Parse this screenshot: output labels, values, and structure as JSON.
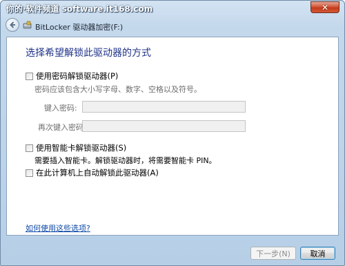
{
  "watermark": "你的·软件频道 software.it168.com",
  "window": {
    "title": "BitLocker 驱动器加密(F:)",
    "close_label": "✕"
  },
  "icons": {
    "back": "back-arrow-icon",
    "app": "bitlocker-icon"
  },
  "main": {
    "heading": "选择希望解锁此驱动器的方式",
    "option_password": "使用密码解锁驱动器(P)",
    "password_hint": "密码应该包含大小写字母、数字、空格以及符号。",
    "enter_password_label": "键入密码:",
    "reenter_password_label": "再次键入密码:",
    "enter_password_value": "",
    "reenter_password_value": "",
    "option_smartcard": "使用智能卡解锁驱动器(S)",
    "smartcard_desc": "需要插入智能卡。解锁驱动器时，将需要智能卡 PIN。",
    "option_auto": "在此计算机上自动解锁此驱动器(A)",
    "help_link": "如何使用这些选项?"
  },
  "buttons": {
    "next": "下一步(N)",
    "cancel": "取消"
  },
  "colors": {
    "heading": "#1e3287",
    "link": "#0c48a6",
    "close_button": "#c23b1c"
  }
}
